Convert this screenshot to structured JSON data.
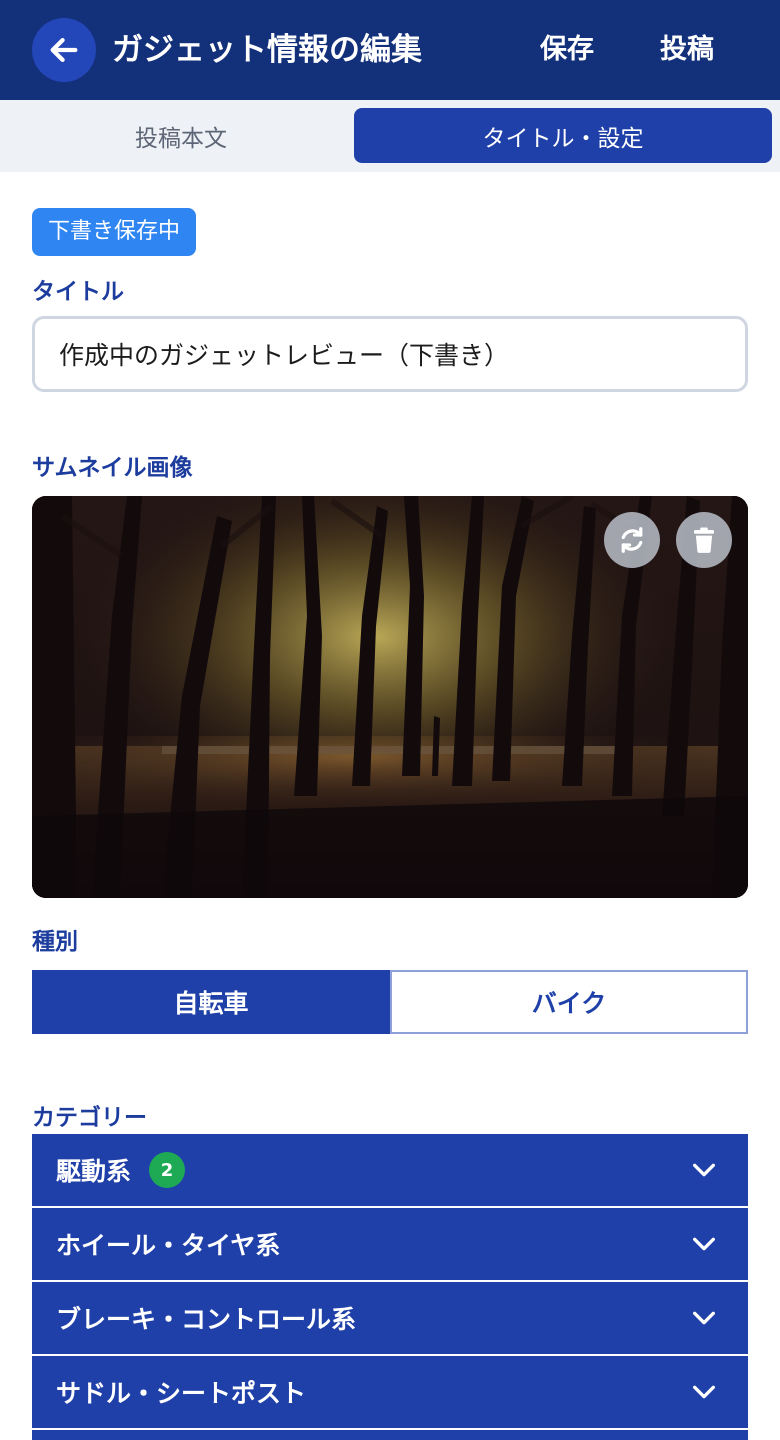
{
  "header": {
    "title": "ガジェット情報の編集",
    "save_label": "保存",
    "post_label": "投稿"
  },
  "tabs": [
    {
      "label": "投稿本文",
      "active": false
    },
    {
      "label": "タイトル・設定",
      "active": true
    }
  ],
  "status": {
    "badge": "下書き保存中"
  },
  "title_field": {
    "label": "タイトル",
    "value": "作成中のガジェットレビュー（下書き）"
  },
  "thumbnail": {
    "label": "サムネイル画像",
    "actions": [
      "refresh-icon",
      "trash-icon"
    ]
  },
  "type_field": {
    "label": "種別",
    "options": [
      "自転車",
      "バイク"
    ],
    "selected": "自転車"
  },
  "category": {
    "label": "カテゴリー",
    "items": [
      {
        "label": "駆動系",
        "count": "2"
      },
      {
        "label": "ホイール・タイヤ系"
      },
      {
        "label": "ブレーキ・コントロール系"
      },
      {
        "label": "サドル・シートポスト"
      }
    ]
  },
  "colors": {
    "header_bg": "#13307a",
    "accent": "#1f40a8",
    "label": "#1c3c9e",
    "badge": "#2f86f2",
    "count_badge": "#1eaa55"
  }
}
